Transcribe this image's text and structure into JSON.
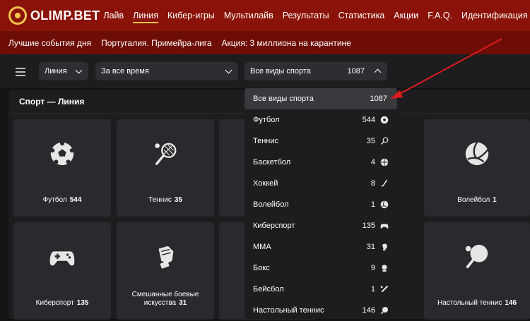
{
  "brand": {
    "name": "OLIMP.BET",
    "accent": "#f0c44a"
  },
  "nav": {
    "items": [
      "Лайв",
      "Линия",
      "Кибер-игры",
      "Мультилайв",
      "Результаты",
      "Статистика",
      "Акции",
      "F.A.Q.",
      "Идентификация"
    ],
    "active": "Линия"
  },
  "subnav": {
    "items": [
      "Лучшие события дня",
      "Португалия. Примейра-лига",
      "Акция: 3 миллиона на карантине"
    ]
  },
  "filters": {
    "mode": "Линия",
    "period": "За все время",
    "sport": "Все виды спорта",
    "sport_count": "1087"
  },
  "panel": {
    "title": "Спорт — Линия"
  },
  "tiles": [
    {
      "label": "Футбол",
      "count": "544",
      "icon": "football-icon"
    },
    {
      "label": "Теннис",
      "count": "35",
      "icon": "tennis-icon"
    },
    {
      "label": "Волейбол",
      "count": "1",
      "icon": "volleyball-icon"
    },
    {
      "label": "Киберспорт",
      "count": "135",
      "icon": "gamepad-icon"
    },
    {
      "label": "Смешанные боевые искусства",
      "count": "31",
      "icon": "mma-glove-icon"
    },
    {
      "label": "Настольный теннис",
      "count": "146",
      "icon": "table-tennis-icon"
    }
  ],
  "dropdown": {
    "items": [
      {
        "label": "Все виды спорта",
        "count": "1087",
        "icon": ""
      },
      {
        "label": "Футбол",
        "count": "544",
        "icon": "football-icon"
      },
      {
        "label": "Теннис",
        "count": "35",
        "icon": "tennis-icon"
      },
      {
        "label": "Баскетбол",
        "count": "4",
        "icon": "basketball-icon"
      },
      {
        "label": "Хоккей",
        "count": "8",
        "icon": "hockey-stick-icon"
      },
      {
        "label": "Волейбол",
        "count": "1",
        "icon": "volleyball-icon"
      },
      {
        "label": "Киберспорт",
        "count": "135",
        "icon": "gamepad-icon"
      },
      {
        "label": "ММА",
        "count": "31",
        "icon": "mma-glove-icon"
      },
      {
        "label": "Бокс",
        "count": "9",
        "icon": "boxing-glove-icon"
      },
      {
        "label": "Бейсбол",
        "count": "1",
        "icon": "baseball-bat-icon"
      },
      {
        "label": "Настольный теннис",
        "count": "146",
        "icon": "table-tennis-icon"
      }
    ]
  }
}
